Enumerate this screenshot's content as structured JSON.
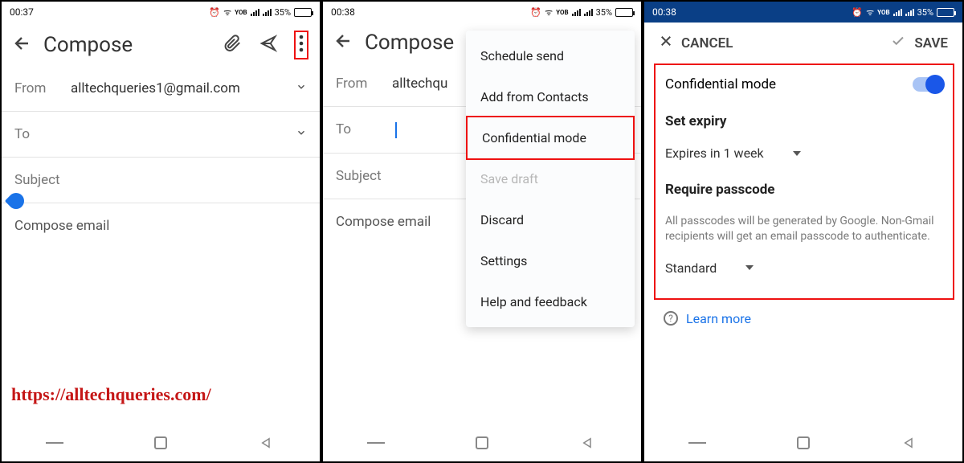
{
  "status": {
    "time1": "00:37",
    "time2": "00:38",
    "battery": "35%",
    "net": "YOB"
  },
  "compose": {
    "title": "Compose",
    "from_label": "From",
    "from_value": "alltechqueries1@gmail.com",
    "to_label": "To",
    "subject_placeholder": "Subject",
    "body_placeholder": "Compose email"
  },
  "menu": {
    "items": [
      {
        "label": "Schedule send",
        "disabled": false
      },
      {
        "label": "Add from Contacts",
        "disabled": false
      },
      {
        "label": "Confidential mode",
        "disabled": false,
        "highlight": true
      },
      {
        "label": "Save draft",
        "disabled": true
      },
      {
        "label": "Discard",
        "disabled": false
      },
      {
        "label": "Settings",
        "disabled": false
      },
      {
        "label": "Help and feedback",
        "disabled": false
      }
    ]
  },
  "conf": {
    "cancel": "CANCEL",
    "save": "SAVE",
    "mode_label": "Confidential mode",
    "expiry_title": "Set expiry",
    "expiry_value": "Expires in 1 week",
    "passcode_title": "Require passcode",
    "passcode_desc": "All passcodes will be generated by Google. Non-Gmail recipients will get an email passcode to authenticate.",
    "passcode_value": "Standard",
    "learn_more": "Learn more"
  },
  "watermark": "https://alltechqueries.com/"
}
